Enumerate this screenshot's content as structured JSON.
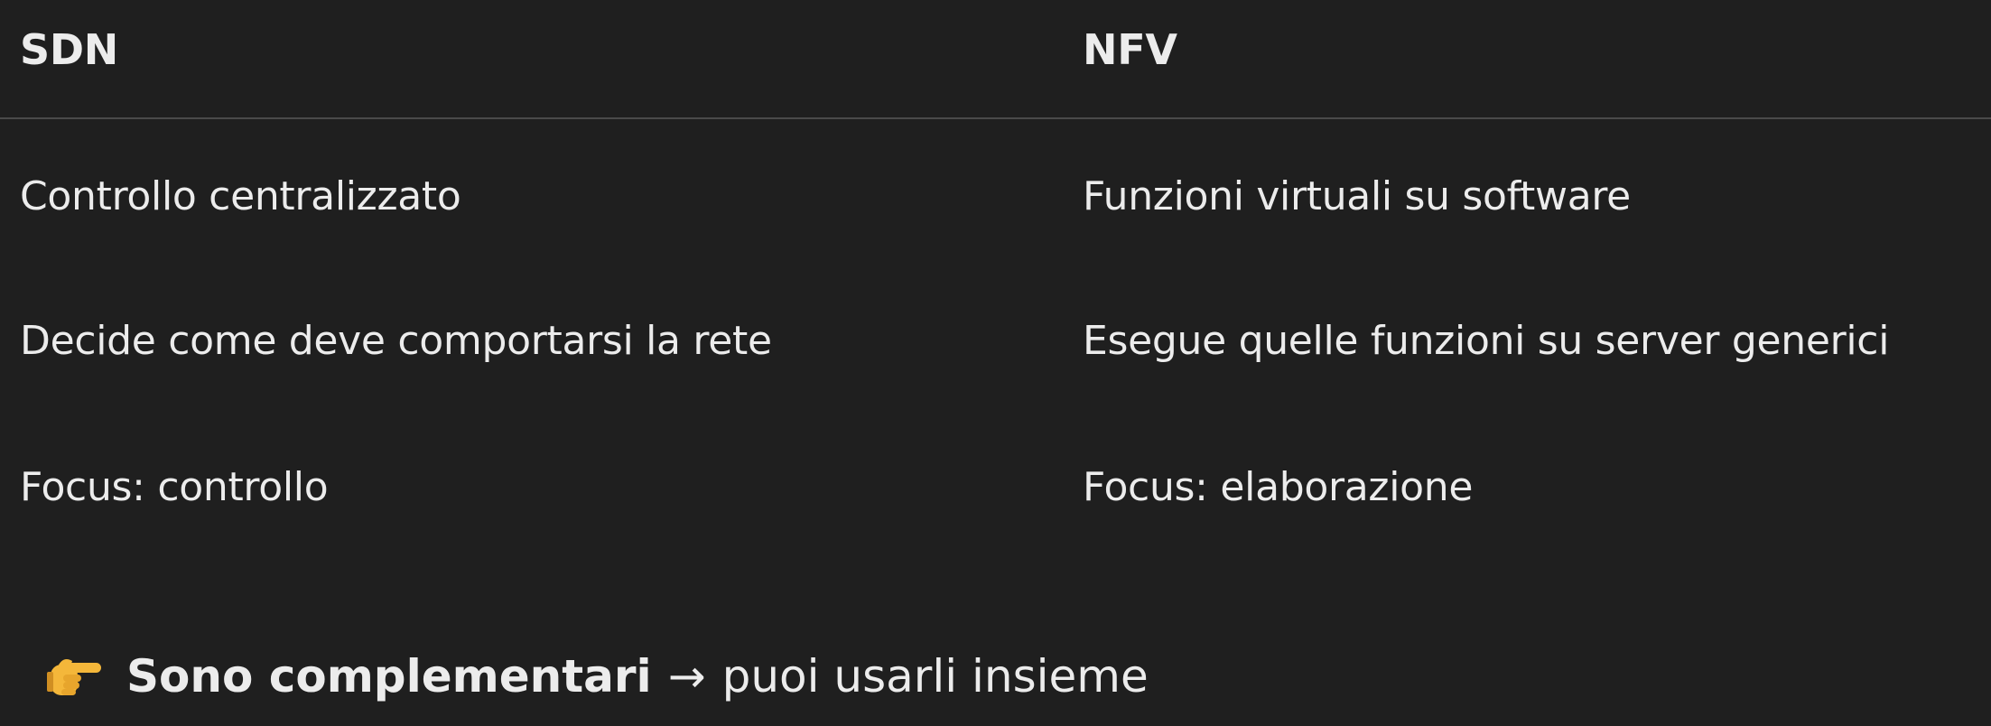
{
  "table": {
    "headers": [
      "SDN",
      "NFV"
    ],
    "rows": [
      [
        "Controllo centralizzato",
        "Funzioni virtuali su software"
      ],
      [
        "Decide come deve comportarsi la rete",
        "Esegue quelle funzioni su server generici"
      ],
      [
        "Focus: controllo",
        "Focus: elaborazione"
      ]
    ]
  },
  "footer": {
    "icon": "pointing-hand-icon",
    "bold_text": "Sono complementari",
    "arrow": "→",
    "text": "puoi usarli insieme"
  },
  "colors": {
    "background": "#1f1f1f",
    "text": "#ececec",
    "divider": "#4a4a4a",
    "emoji": "#f4b73a"
  }
}
